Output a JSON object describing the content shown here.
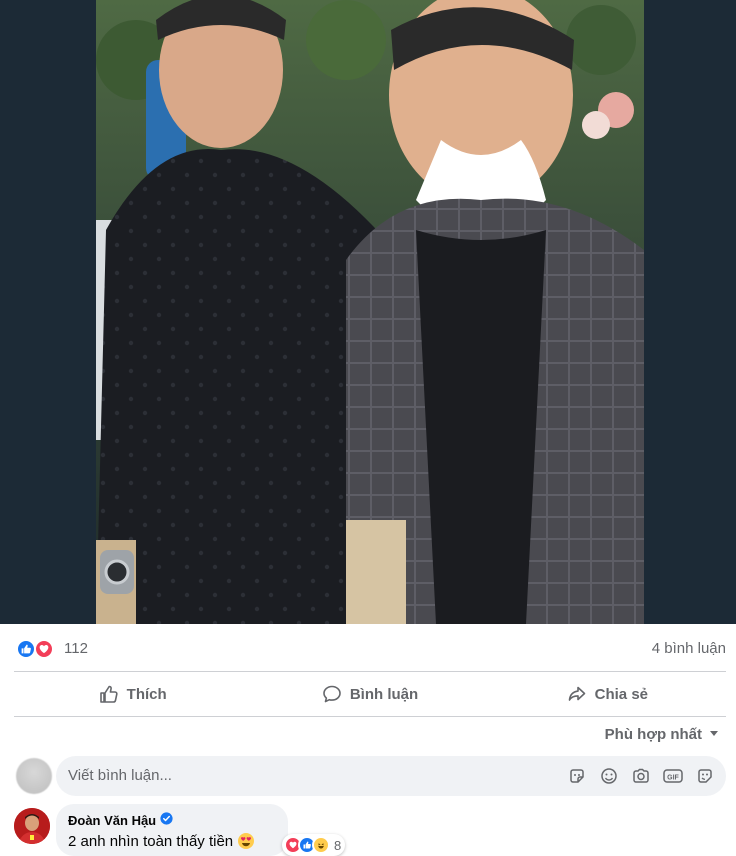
{
  "post": {
    "reaction_count": "112",
    "comment_count": "4 bình luận",
    "reactions": [
      "like-icon",
      "love-icon"
    ]
  },
  "actions": {
    "like_label": "Thích",
    "comment_label": "Bình luận",
    "share_label": "Chia sẻ"
  },
  "sort": {
    "label": "Phù hợp nhất"
  },
  "composer": {
    "placeholder": "Viết bình luận...",
    "tools": [
      "sticker-icon",
      "emoji-icon",
      "camera-icon",
      "gif-icon",
      "avatar-sticker-icon"
    ]
  },
  "comments": [
    {
      "author": "Đoàn Văn Hậu",
      "verified": true,
      "text": "2 anh nhìn toàn thấy tiền",
      "emoji": "heart-eyes-emoji",
      "reaction_count": "8",
      "reactions": [
        "love-icon",
        "like-icon",
        "haha-icon"
      ]
    }
  ],
  "colors": {
    "photo_background": "#1c2a36",
    "accent_blue": "#1877f2",
    "love_red": "#f33e58",
    "muted_text": "#65676b",
    "input_background": "#f0f2f5"
  }
}
